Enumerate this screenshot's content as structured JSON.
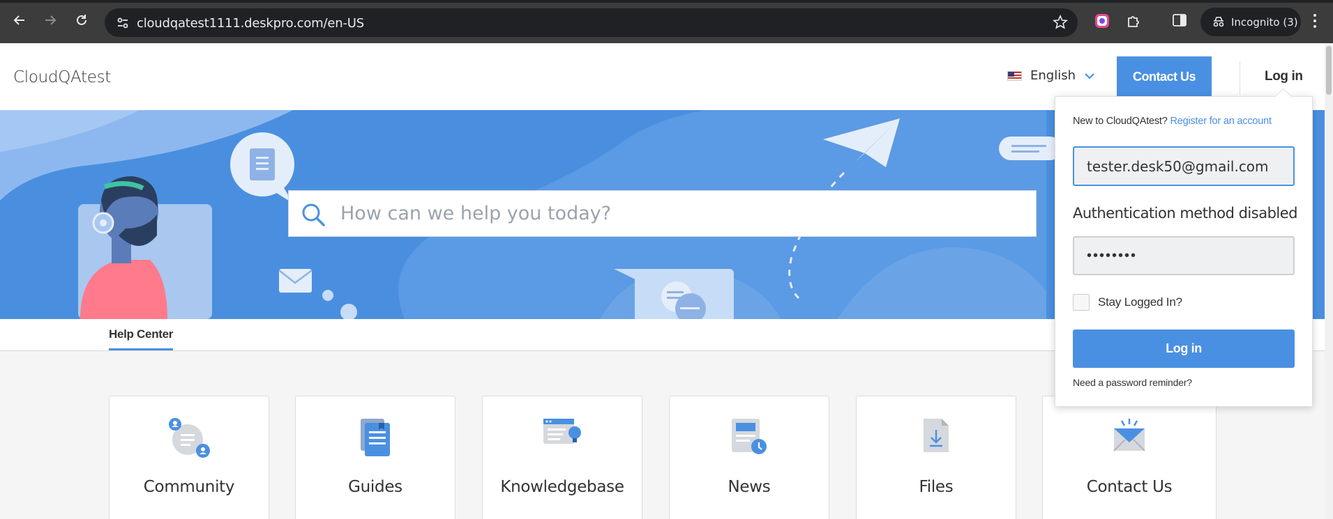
{
  "browser": {
    "url": "cloudqatest1111.deskpro.com/en-US",
    "incognito_label": "Incognito (3)"
  },
  "header": {
    "brand": "CloudQAtest",
    "language": "English",
    "contact_label": "Contact Us",
    "login_label": "Log in"
  },
  "hero": {
    "search_placeholder": "How can we help you today?"
  },
  "subnav": {
    "tab": "Help Center"
  },
  "cards": [
    {
      "label": "Community",
      "icon": "community-icon"
    },
    {
      "label": "Guides",
      "icon": "guides-icon"
    },
    {
      "label": "Knowledgebase",
      "icon": "knowledgebase-icon"
    },
    {
      "label": "News",
      "icon": "news-icon"
    },
    {
      "label": "Files",
      "icon": "files-icon"
    },
    {
      "label": "Contact Us",
      "icon": "envelope-icon"
    }
  ],
  "login_popup": {
    "new_to": "New to CloudQAtest?",
    "register_link": "Register for an account",
    "email_value": "tester.desk50@gmail.com",
    "auth_message": "Authentication method disabled",
    "password_value": "••••••••",
    "stay_logged_in": "Stay Logged In?",
    "login_button": "Log in",
    "password_reminder": "Need a password reminder?"
  },
  "colors": {
    "accent": "#4a90e2",
    "hero": "#4a8fdf"
  }
}
